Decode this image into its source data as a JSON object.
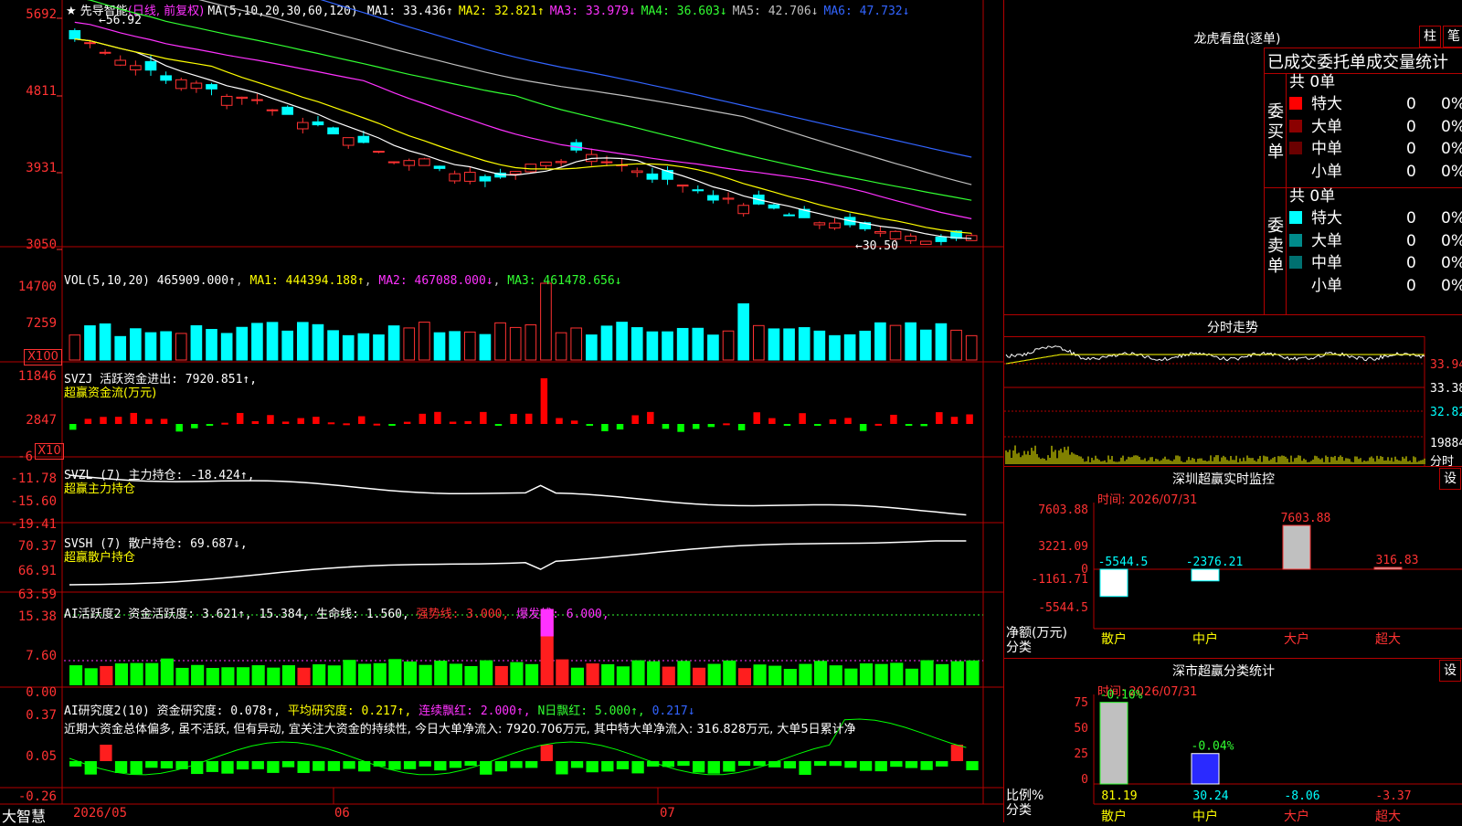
{
  "stock": {
    "star": "★",
    "name": "先导智能",
    "period": "(日线, 前复权)",
    "ma_label": "MA(5,10,20,30,60,120)",
    "ma": [
      {
        "label": "MA1:",
        "value": "33.436↑",
        "color": "#ffffff"
      },
      {
        "label": "MA2:",
        "value": "32.821↑",
        "color": "#ffff00"
      },
      {
        "label": "MA3:",
        "value": "33.979↓",
        "color": "#ff32ff"
      },
      {
        "label": "MA4:",
        "value": "36.603↓",
        "color": "#32ff32"
      },
      {
        "label": "MA5:",
        "value": "42.706↓",
        "color": "#c0c0c0"
      },
      {
        "label": "MA6:",
        "value": "47.732↓",
        "color": "#3264ff"
      }
    ],
    "price_axis": [
      "5692",
      "4811",
      "3931",
      "3050"
    ],
    "high_label": "56.92",
    "low_label": "30.50"
  },
  "vol": {
    "title": "VOL(5,10,20)",
    "value": "465909.000↑",
    "ma1": "MA1: 444394.188↑",
    "ma2": "MA2: 467088.000↓",
    "ma3": "MA3: 461478.656↓",
    "axis": [
      "14700",
      "7259"
    ],
    "unit": "X100"
  },
  "svzj": {
    "title": "SVZJ  活跃资金进出: 7920.851↑,",
    "sub": "超赢资金流(万元)",
    "axis": [
      "11846",
      "2847",
      "-6"
    ],
    "unit": "X10"
  },
  "svzl": {
    "title": "SVZL (7) 主力持仓: -18.424↑,",
    "sub": "超赢主力持仓",
    "axis": [
      "-11.78",
      "-15.60",
      "-19.41"
    ]
  },
  "svsh": {
    "title": "SVSH (7) 散户持仓: 69.687↓,",
    "sub": "超赢散户持仓",
    "axis": [
      "70.37",
      "66.91",
      "63.59"
    ]
  },
  "ai1": {
    "title": "AI活跃度2 资金活跃度: 3.621↑, 15.384, 生命线: 1.560,",
    "strong": "强势线: 3.000,",
    "burst": "爆发线: 6.000,",
    "axis": [
      "15.38",
      "7.60",
      "0.00"
    ]
  },
  "ai2": {
    "title": "AI研究度2(10) 资金研究度: 0.078↑,",
    "avg": "平均研究度: 0.217↑,",
    "red_days": "连续飘红: 2.000↑,",
    "n_red": "N日飘红: 5.000↑,",
    "tail": "0.217↓",
    "comment": "近期大资金总体偏多, 虽不活跃, 但有异动, 宜关注大资金的持续性, 今日大单净流入: 7920.706万元, 其中特大单净流入: 316.828万元, 大单5日累计净",
    "axis": [
      "0.37",
      "0.05",
      "-0.26"
    ]
  },
  "dates": {
    "brand": "大智慧",
    "d1": "2026/05",
    "d2": "06",
    "d3": "07"
  },
  "right": {
    "lhb_title": "龙虎看盘(逐单)",
    "btn_zhu": "柱",
    "btn_bi": "笔",
    "stats_title": "已成交委托单成交量统计",
    "buy": {
      "label": "委买单",
      "total": "共 0单",
      "rows": [
        {
          "name": "特大",
          "count": "0",
          "pct": "0%",
          "color": "#ff0000"
        },
        {
          "name": "大单",
          "count": "0",
          "pct": "0%",
          "color": "#8b0000"
        },
        {
          "name": "中单",
          "count": "0",
          "pct": "0%",
          "color": "#6a0000"
        },
        {
          "name": "小单",
          "count": "0",
          "pct": "0%",
          "color": "#000000"
        }
      ]
    },
    "sell": {
      "label": "委卖单",
      "total": "共 0单",
      "rows": [
        {
          "name": "特大",
          "count": "0",
          "pct": "0%",
          "color": "#00ffff"
        },
        {
          "name": "大单",
          "count": "0",
          "pct": "0%",
          "color": "#008b8b"
        },
        {
          "name": "中单",
          "count": "0",
          "pct": "0%",
          "color": "#007070"
        },
        {
          "name": "小单",
          "count": "0",
          "pct": "0%",
          "color": "#000000"
        }
      ]
    },
    "minute_title": "分时走势",
    "minute_axis": [
      "33.94",
      "33.38",
      "32.82",
      "19884",
      "分时"
    ],
    "monitor": {
      "title": "深圳超赢实时监控",
      "btn": "设",
      "time": "时间: 2026/07/31",
      "axis": [
        "7603.88",
        "3221.09",
        "0",
        "-1161.71",
        "-5544.5"
      ],
      "ylabel": "净额(万元)",
      "xlabel": "分类",
      "bars": [
        {
          "cat": "散户",
          "value": -5544.5,
          "label": "-5544.5"
        },
        {
          "cat": "中户",
          "value": -2376.21,
          "label": "-2376.21"
        },
        {
          "cat": "大户",
          "value": 7603.88,
          "label": "7603.88"
        },
        {
          "cat": "超大",
          "value": 316.83,
          "label": "316.83"
        }
      ]
    },
    "classify": {
      "title": "深市超赢分类统计",
      "btn": "设",
      "time": "时间: 2026/07/31",
      "axis": [
        "75",
        "50",
        "25",
        "0"
      ],
      "ylabel": "比例%",
      "xlabel": "分类",
      "bars": [
        {
          "cat": "散户",
          "value": 81.19,
          "label": "81.19",
          "top": "-0.10%"
        },
        {
          "cat": "中户",
          "value": 30.24,
          "label": "30.24",
          "top": "-0.04%"
        },
        {
          "cat": "大户",
          "value": 0,
          "label": "-8.06",
          "top": ""
        },
        {
          "cat": "超大",
          "value": 0,
          "label": "-3.37",
          "top": ""
        }
      ]
    }
  },
  "colors": {
    "up": "#ff3232",
    "down": "#00ffff",
    "grid": "#b40000"
  }
}
